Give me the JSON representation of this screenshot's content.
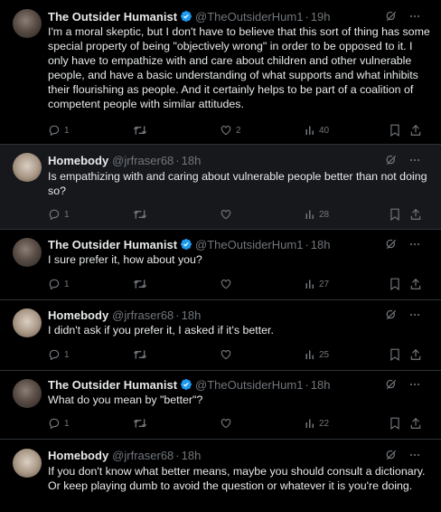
{
  "tweets": [
    {
      "author": "The Outsider Humanist",
      "verified": true,
      "handle": "@TheOutsiderHum1",
      "time": "19h",
      "text": "I'm a moral skeptic, but I don't have to believe that this sort of thing has some special property of being \"objectively wrong\" in order to be opposed to it. I only have to empathize with and care about children and other vulnerable people, and have a basic understanding of what supports and what inhibits their flourishing as people. And it certainly helps to be part of a coalition of competent people with similar attitudes.",
      "replies": "1",
      "retweets": "",
      "likes": "2",
      "views": "40"
    },
    {
      "author": "Homebody",
      "verified": false,
      "handle": "@jrfraser68",
      "time": "18h",
      "text": "Is empathizing with and caring about vulnerable people better than not doing so?",
      "replies": "1",
      "retweets": "",
      "likes": "",
      "views": "28"
    },
    {
      "author": "The Outsider Humanist",
      "verified": true,
      "handle": "@TheOutsiderHum1",
      "time": "18h",
      "text": "I sure prefer it, how about you?",
      "replies": "1",
      "retweets": "",
      "likes": "",
      "views": "27"
    },
    {
      "author": "Homebody",
      "verified": false,
      "handle": "@jrfraser68",
      "time": "18h",
      "text": "I didn't ask if you prefer it, I asked if it's better.",
      "replies": "1",
      "retweets": "",
      "likes": "",
      "views": "25"
    },
    {
      "author": "The Outsider Humanist",
      "verified": true,
      "handle": "@TheOutsiderHum1",
      "time": "18h",
      "text": "What do you mean by \"better\"?",
      "replies": "1",
      "retweets": "",
      "likes": "",
      "views": "22"
    },
    {
      "author": "Homebody",
      "verified": false,
      "handle": "@jrfraser68",
      "time": "18h",
      "text": "If you don't know what better means, maybe you should consult a dictionary. Or keep playing dumb to avoid the question or whatever it is you're doing.",
      "replies": "",
      "retweets": "",
      "likes": "",
      "views": ""
    }
  ],
  "colors": {
    "background": "#000000",
    "highlight": "#16181c",
    "muted": "#71767b",
    "verified": "#1d9bf0",
    "text": "#e7e9ea"
  },
  "icons": [
    "verified-badge-icon",
    "grok-icon",
    "more-icon",
    "reply-icon",
    "retweet-icon",
    "like-icon",
    "views-icon",
    "bookmark-icon",
    "share-icon"
  ]
}
